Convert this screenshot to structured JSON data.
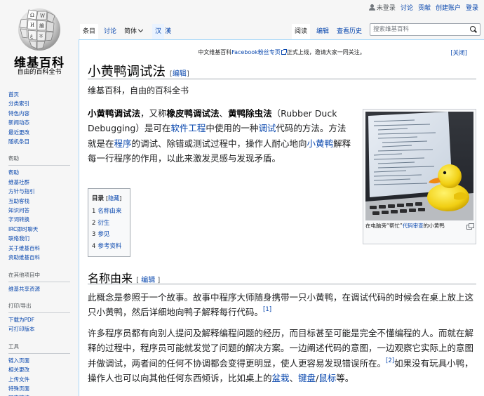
{
  "personal": {
    "not_logged_in": "未登录",
    "talk": "讨论",
    "contributions": "贡献",
    "create_account": "创建账户",
    "login": "登录"
  },
  "logo": {
    "title": "维基百科",
    "tagline": "自由的百科全书"
  },
  "sidebar": {
    "main_nav": [
      "首页",
      "分类索引",
      "特色内容",
      "新闻动态",
      "最近更改",
      "随机条目"
    ],
    "portals": [
      {
        "heading": "帮助",
        "items": [
          "帮助",
          "维基社群",
          "方针与指引",
          "互助客栈",
          "知识问答",
          "字词转换",
          "IRC即时聊天",
          "联络我们",
          "关于维基百科",
          "资助维基百科"
        ]
      },
      {
        "heading": "在其他项目中",
        "items": [
          "维基共享资源"
        ]
      },
      {
        "heading": "打印/导出",
        "items": [
          "下载为PDF",
          "可打印版本"
        ]
      },
      {
        "heading": "工具",
        "items": [
          "链入页面",
          "相关更改",
          "上传文件",
          "特殊页面",
          "固定链接"
        ]
      }
    ]
  },
  "tabs": {
    "article": "条目",
    "talk": "讨论",
    "variant": "简体",
    "hans": "汉",
    "hant": "漢",
    "read": "阅读",
    "edit": "编辑",
    "history": "查看历史"
  },
  "search": {
    "placeholder": "搜索维基百科"
  },
  "sitenotice": {
    "before": "中文维基百科",
    "link": "Facebook粉丝专页",
    "after": "正式上线，邀请大家一同关注。",
    "close": "[关闭]"
  },
  "article": {
    "title": "小黄鸭调试法",
    "edit_open": "[",
    "edit_label": "编辑",
    "edit_close": "]",
    "site_sub": "维基百科，自由的百科全书",
    "lead": {
      "term1": "小黄鸭调试法",
      "t1": "，又称",
      "term2": "橡皮鸭调试法",
      "t2": "、",
      "term3": "黄鸭除虫法",
      "t3": "（Rubber Duck Debugging）是可在",
      "link1": "软件工程",
      "t4": "中使用的一种",
      "link2": "调试",
      "t5": "代码的方法。方法就是在",
      "link3": "程序",
      "t6": "的调试、除错或测试过程中，操作人耐心地向",
      "link4": "小黄鸭",
      "t7": "解释每一行程序的作用，以此来激发灵感与发现矛盾。"
    },
    "thumb": {
      "caption_before": "在电脑旁“帮忙”",
      "caption_link": "代码审查",
      "caption_after": "的小黄鸭"
    },
    "toc": {
      "title": "目录",
      "toggle_open": "[",
      "toggle": "隐藏",
      "toggle_close": "]",
      "items": [
        {
          "number": "1",
          "label": "名称由来"
        },
        {
          "number": "2",
          "label": "衍生"
        },
        {
          "number": "3",
          "label": "参见"
        },
        {
          "number": "4",
          "label": "参考资料"
        }
      ]
    },
    "section1": {
      "heading": "名称由来",
      "edit_open": "[",
      "edit_label": "编辑",
      "edit_close": "]",
      "para1": "此概念是参照于一个故事。故事中程序大师随身携带一只小黄鸭，在调试代码的时候会在桌上放上这只小黄鸭，然后详细地向鸭子解释每行代码。",
      "ref1": "[1]",
      "para2_a": "许多程序员都有向别人提问及解释编程问题的经历，而目标甚至可能是完全不懂编程的人。而就在解释的过程中，程序员可能就发觉了问题的解决方案。一边阐述代码的意图，一边观察它实际上的意图并做调试，两者间的任何不协调都会变得更明显，使人更容易发现错误所在。",
      "ref2": "[2]",
      "para2_b": "如果没有玩具小鸭，操作人也可以向其他任何东西倾诉，比如桌上的",
      "link_keyboard1": "盆栽",
      "sep1": "、",
      "link_keyboard2": "键盘",
      "sep2": "/",
      "link_mouse": "鼠标",
      "para2_c": "等。"
    }
  },
  "colors": {
    "link": "#0645ad",
    "text": "#202122",
    "border": "#a7d7f9",
    "background": "#f6f6f6"
  }
}
